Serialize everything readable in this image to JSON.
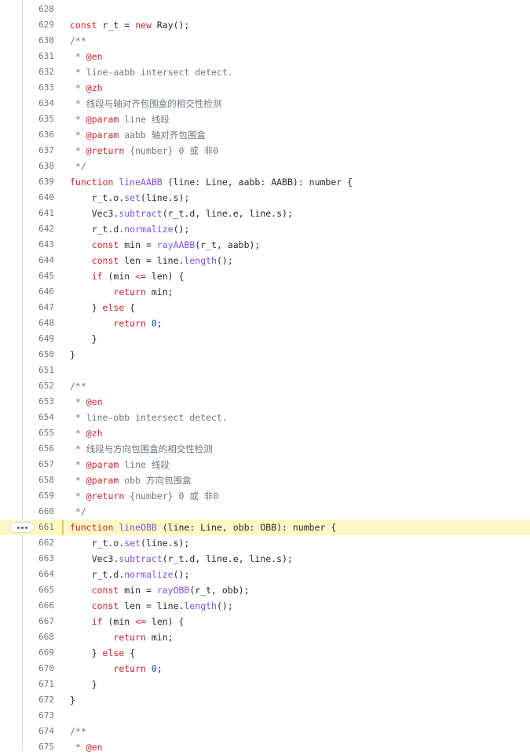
{
  "viewer": {
    "lines": [
      {
        "num": "628",
        "tokens": []
      },
      {
        "num": "629",
        "tokens": [
          {
            "t": "kw",
            "v": "const"
          },
          {
            "t": "pl",
            "v": " r_t = "
          },
          {
            "t": "kw",
            "v": "new"
          },
          {
            "t": "pl",
            "v": " Ray();"
          }
        ]
      },
      {
        "num": "630",
        "tokens": [
          {
            "t": "cm",
            "v": "/**"
          }
        ]
      },
      {
        "num": "631",
        "tokens": [
          {
            "t": "cm",
            "v": " * "
          },
          {
            "t": "kw",
            "v": "@en"
          }
        ]
      },
      {
        "num": "632",
        "tokens": [
          {
            "t": "cm",
            "v": " * line-aabb intersect detect."
          }
        ]
      },
      {
        "num": "633",
        "tokens": [
          {
            "t": "cm",
            "v": " * "
          },
          {
            "t": "kw",
            "v": "@zh"
          }
        ]
      },
      {
        "num": "634",
        "tokens": [
          {
            "t": "cm",
            "v": " * 线段与轴对齐包围盒的相交性检测"
          }
        ]
      },
      {
        "num": "635",
        "tokens": [
          {
            "t": "cm",
            "v": " * "
          },
          {
            "t": "kw",
            "v": "@param"
          },
          {
            "t": "cm",
            "v": " line 线段"
          }
        ]
      },
      {
        "num": "636",
        "tokens": [
          {
            "t": "cm",
            "v": " * "
          },
          {
            "t": "kw",
            "v": "@param"
          },
          {
            "t": "cm",
            "v": " aabb 轴对齐包围盒"
          }
        ]
      },
      {
        "num": "637",
        "tokens": [
          {
            "t": "cm",
            "v": " * "
          },
          {
            "t": "kw",
            "v": "@return"
          },
          {
            "t": "cm",
            "v": " {number} 0 或 非0"
          }
        ]
      },
      {
        "num": "638",
        "tokens": [
          {
            "t": "cm",
            "v": " */"
          }
        ]
      },
      {
        "num": "639",
        "tokens": [
          {
            "t": "kw",
            "v": "function"
          },
          {
            "t": "pl",
            "v": " "
          },
          {
            "t": "fn",
            "v": "lineAABB"
          },
          {
            "t": "pl",
            "v": " (line: Line, aabb: AABB): number {"
          }
        ]
      },
      {
        "num": "640",
        "tokens": [
          {
            "t": "pl",
            "v": "    r_t.o."
          },
          {
            "t": "fn",
            "v": "set"
          },
          {
            "t": "pl",
            "v": "(line.s);"
          }
        ]
      },
      {
        "num": "641",
        "tokens": [
          {
            "t": "pl",
            "v": "    Vec3."
          },
          {
            "t": "fn",
            "v": "subtract"
          },
          {
            "t": "pl",
            "v": "(r_t.d, line.e, line.s);"
          }
        ]
      },
      {
        "num": "642",
        "tokens": [
          {
            "t": "pl",
            "v": "    r_t.d."
          },
          {
            "t": "fn",
            "v": "normalize"
          },
          {
            "t": "pl",
            "v": "();"
          }
        ]
      },
      {
        "num": "643",
        "tokens": [
          {
            "t": "pl",
            "v": "    "
          },
          {
            "t": "kw",
            "v": "const"
          },
          {
            "t": "pl",
            "v": " min = "
          },
          {
            "t": "fn",
            "v": "rayAABB"
          },
          {
            "t": "pl",
            "v": "(r_t, aabb);"
          }
        ]
      },
      {
        "num": "644",
        "tokens": [
          {
            "t": "pl",
            "v": "    "
          },
          {
            "t": "kw",
            "v": "const"
          },
          {
            "t": "pl",
            "v": " len = line."
          },
          {
            "t": "fn",
            "v": "length"
          },
          {
            "t": "pl",
            "v": "();"
          }
        ]
      },
      {
        "num": "645",
        "tokens": [
          {
            "t": "pl",
            "v": "    "
          },
          {
            "t": "kw",
            "v": "if"
          },
          {
            "t": "pl",
            "v": " (min "
          },
          {
            "t": "kw",
            "v": "<="
          },
          {
            "t": "pl",
            "v": " len) {"
          }
        ]
      },
      {
        "num": "646",
        "tokens": [
          {
            "t": "pl",
            "v": "        "
          },
          {
            "t": "kw",
            "v": "return"
          },
          {
            "t": "pl",
            "v": " min;"
          }
        ]
      },
      {
        "num": "647",
        "tokens": [
          {
            "t": "pl",
            "v": "    } "
          },
          {
            "t": "kw",
            "v": "else"
          },
          {
            "t": "pl",
            "v": " {"
          }
        ]
      },
      {
        "num": "648",
        "tokens": [
          {
            "t": "pl",
            "v": "        "
          },
          {
            "t": "kw",
            "v": "return"
          },
          {
            "t": "pl",
            "v": " "
          },
          {
            "t": "nm",
            "v": "0"
          },
          {
            "t": "pl",
            "v": ";"
          }
        ]
      },
      {
        "num": "649",
        "tokens": [
          {
            "t": "pl",
            "v": "    }"
          }
        ]
      },
      {
        "num": "650",
        "tokens": [
          {
            "t": "pl",
            "v": "}"
          }
        ]
      },
      {
        "num": "651",
        "tokens": []
      },
      {
        "num": "652",
        "tokens": [
          {
            "t": "cm",
            "v": "/**"
          }
        ]
      },
      {
        "num": "653",
        "tokens": [
          {
            "t": "cm",
            "v": " * "
          },
          {
            "t": "kw",
            "v": "@en"
          }
        ]
      },
      {
        "num": "654",
        "tokens": [
          {
            "t": "cm",
            "v": " * line-obb intersect detect."
          }
        ]
      },
      {
        "num": "655",
        "tokens": [
          {
            "t": "cm",
            "v": " * "
          },
          {
            "t": "kw",
            "v": "@zh"
          }
        ]
      },
      {
        "num": "656",
        "tokens": [
          {
            "t": "cm",
            "v": " * 线段与方向包围盒的相交性检测"
          }
        ]
      },
      {
        "num": "657",
        "tokens": [
          {
            "t": "cm",
            "v": " * "
          },
          {
            "t": "kw",
            "v": "@param"
          },
          {
            "t": "cm",
            "v": " line 线段"
          }
        ]
      },
      {
        "num": "658",
        "tokens": [
          {
            "t": "cm",
            "v": " * "
          },
          {
            "t": "kw",
            "v": "@param"
          },
          {
            "t": "cm",
            "v": " obb 方向包围盒"
          }
        ]
      },
      {
        "num": "659",
        "tokens": [
          {
            "t": "cm",
            "v": " * "
          },
          {
            "t": "kw",
            "v": "@return"
          },
          {
            "t": "cm",
            "v": " {number} 0 或 非0"
          }
        ]
      },
      {
        "num": "660",
        "tokens": [
          {
            "t": "cm",
            "v": " */"
          }
        ]
      },
      {
        "num": "661",
        "highlighted": true,
        "tokens": [
          {
            "t": "kw",
            "v": "function"
          },
          {
            "t": "pl",
            "v": " "
          },
          {
            "t": "fn",
            "v": "lineOBB"
          },
          {
            "t": "pl",
            "v": " (line: Line, obb: OBB): number {"
          }
        ]
      },
      {
        "num": "662",
        "tokens": [
          {
            "t": "pl",
            "v": "    r_t.o."
          },
          {
            "t": "fn",
            "v": "set"
          },
          {
            "t": "pl",
            "v": "(line.s);"
          }
        ]
      },
      {
        "num": "663",
        "tokens": [
          {
            "t": "pl",
            "v": "    Vec3."
          },
          {
            "t": "fn",
            "v": "subtract"
          },
          {
            "t": "pl",
            "v": "(r_t.d, line.e, line.s);"
          }
        ]
      },
      {
        "num": "664",
        "tokens": [
          {
            "t": "pl",
            "v": "    r_t.d."
          },
          {
            "t": "fn",
            "v": "normalize"
          },
          {
            "t": "pl",
            "v": "();"
          }
        ]
      },
      {
        "num": "665",
        "tokens": [
          {
            "t": "pl",
            "v": "    "
          },
          {
            "t": "kw",
            "v": "const"
          },
          {
            "t": "pl",
            "v": " min = "
          },
          {
            "t": "fn",
            "v": "rayOBB"
          },
          {
            "t": "pl",
            "v": "(r_t, obb);"
          }
        ]
      },
      {
        "num": "666",
        "tokens": [
          {
            "t": "pl",
            "v": "    "
          },
          {
            "t": "kw",
            "v": "const"
          },
          {
            "t": "pl",
            "v": " len = line."
          },
          {
            "t": "fn",
            "v": "length"
          },
          {
            "t": "pl",
            "v": "();"
          }
        ]
      },
      {
        "num": "667",
        "tokens": [
          {
            "t": "pl",
            "v": "    "
          },
          {
            "t": "kw",
            "v": "if"
          },
          {
            "t": "pl",
            "v": " (min "
          },
          {
            "t": "kw",
            "v": "<="
          },
          {
            "t": "pl",
            "v": " len) {"
          }
        ]
      },
      {
        "num": "668",
        "tokens": [
          {
            "t": "pl",
            "v": "        "
          },
          {
            "t": "kw",
            "v": "return"
          },
          {
            "t": "pl",
            "v": " min;"
          }
        ]
      },
      {
        "num": "669",
        "tokens": [
          {
            "t": "pl",
            "v": "    } "
          },
          {
            "t": "kw",
            "v": "else"
          },
          {
            "t": "pl",
            "v": " {"
          }
        ]
      },
      {
        "num": "670",
        "tokens": [
          {
            "t": "pl",
            "v": "        "
          },
          {
            "t": "kw",
            "v": "return"
          },
          {
            "t": "pl",
            "v": " "
          },
          {
            "t": "nm",
            "v": "0"
          },
          {
            "t": "pl",
            "v": ";"
          }
        ]
      },
      {
        "num": "671",
        "tokens": [
          {
            "t": "pl",
            "v": "    }"
          }
        ]
      },
      {
        "num": "672",
        "tokens": [
          {
            "t": "pl",
            "v": "}"
          }
        ]
      },
      {
        "num": "673",
        "tokens": []
      },
      {
        "num": "674",
        "tokens": [
          {
            "t": "cm",
            "v": "/**"
          }
        ]
      },
      {
        "num": "675",
        "tokens": [
          {
            "t": "cm",
            "v": " * "
          },
          {
            "t": "kw",
            "v": "@en"
          }
        ]
      }
    ],
    "more_button_icon": "kebab-horizontal-icon",
    "colors": {
      "keyword": "#cf222e",
      "comment": "#6e7781",
      "function": "#8250df",
      "plain": "#24292f",
      "number": "#0550ae",
      "highlight_bg": "#fff8c5",
      "highlight_border": "#eac54f"
    }
  }
}
